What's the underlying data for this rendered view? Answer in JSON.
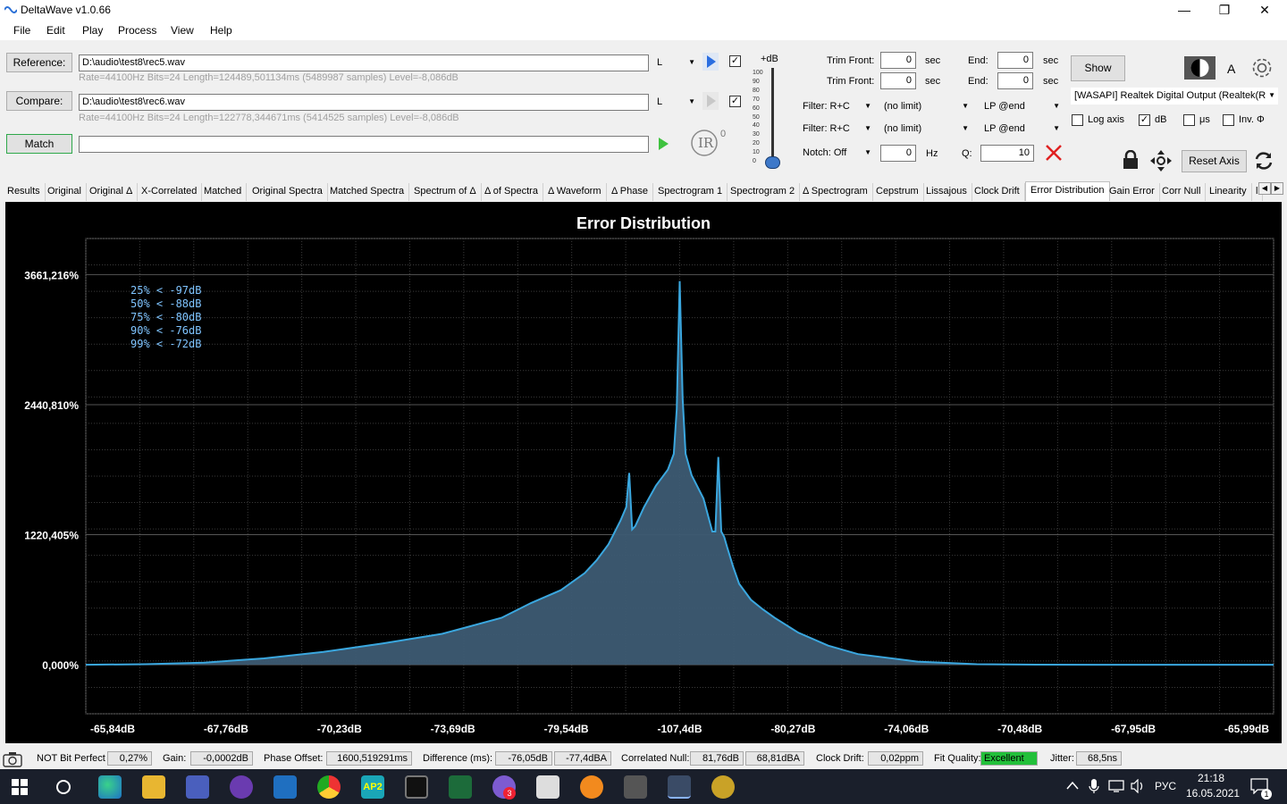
{
  "window": {
    "title": "DeltaWave v1.0.66",
    "minimize_glyph": "—",
    "maximize_glyph": "❐",
    "close_glyph": "✕"
  },
  "menu": [
    "File",
    "Edit",
    "Play",
    "Process",
    "View",
    "Help"
  ],
  "reference": {
    "button": "Reference:",
    "path": "D:\\audio\\test8\\rec5.wav",
    "channel": "L",
    "info": "Rate=44100Hz Bits=24 Length=124489,501134ms (5489987 samples) Level=-8,086dB"
  },
  "compare": {
    "button": "Compare:",
    "path": "D:\\audio\\test8\\rec6.wav",
    "channel": "L",
    "info": "Rate=44100Hz Bits=24 Length=122778,344671ms (5414525 samples) Level=-8,086dB"
  },
  "match": {
    "button": "Match",
    "field": ""
  },
  "ir": {
    "label": "IR",
    "sup": "0"
  },
  "level_slider": {
    "label": "+dB",
    "ticks": [
      "100",
      "90",
      "80",
      "70",
      "60",
      "50",
      "40",
      "30",
      "20",
      "10",
      "0"
    ],
    "value": 0
  },
  "trim": {
    "front_label": "Trim Front:",
    "end_label": "End:",
    "unit": "sec",
    "row1": {
      "front": "0",
      "end": "0"
    },
    "row2": {
      "front": "0",
      "end": "0"
    }
  },
  "filters": {
    "row1": {
      "filter": "Filter: R+C",
      "limit": "(no limit)",
      "lp": "LP @end"
    },
    "row2": {
      "filter": "Filter: R+C",
      "limit": "(no limit)",
      "lp": "LP @end"
    },
    "notch": "Notch: Off",
    "notch_value": "0",
    "notch_unit": "Hz",
    "q_label": "Q:",
    "q_value": "10"
  },
  "right_panel": {
    "show_button": "Show",
    "a_label": "A",
    "output_device": "[WASAPI] Realtek Digital Output (Realtek(R",
    "log_axis": "Log axis",
    "db": "dB",
    "us": "μs",
    "inv": "Inv. Φ",
    "checked_mark": "✓",
    "reset_axis": "Reset Axis"
  },
  "tabs": [
    "Results",
    "Original",
    "Original Δ",
    "X-Correlated",
    "Matched",
    "Original Spectra",
    "Matched Spectra",
    "Spectrum of Δ",
    "Δ of Spectra",
    "Δ Waveform",
    "Δ Phase",
    "Spectrogram 1",
    "Spectrogram 2",
    "Δ Spectrogram",
    "Cepstrum",
    "Lissajous",
    "Clock Drift",
    "Error Distribution",
    "Gain Error",
    "Corr Null",
    "Linearity",
    "l"
  ],
  "active_tab": "Error Distribution",
  "chart_data": {
    "type": "area",
    "title": "Error Distribution",
    "x_tick_labels": [
      "-65,84dB",
      "-67,76dB",
      "-70,23dB",
      "-73,69dB",
      "-79,54dB",
      "-107,4dB",
      "-80,27dB",
      "-74,06dB",
      "-70,48dB",
      "-67,95dB",
      "-65,99dB"
    ],
    "y_tick_labels": [
      "0,000%",
      "1220,405%",
      "2440,810%",
      "3661,216%"
    ],
    "ylim": [
      -460,
      4000
    ],
    "y_ticks": [
      0,
      1220.405,
      2440.81,
      3661.216
    ],
    "xlim": [
      -1,
      1
    ],
    "x": [
      -1,
      -0.9,
      -0.8,
      -0.7,
      -0.6,
      -0.5,
      -0.4,
      -0.3,
      -0.25,
      -0.2,
      -0.16,
      -0.14,
      -0.12,
      -0.1,
      -0.09,
      -0.085,
      -0.08,
      -0.075,
      -0.07,
      -0.06,
      -0.04,
      -0.02,
      -0.01,
      -0.005,
      0,
      0.005,
      0.01,
      0.02,
      0.04,
      0.055,
      0.06,
      0.065,
      0.07,
      0.075,
      0.08,
      0.09,
      0.1,
      0.12,
      0.14,
      0.16,
      0.2,
      0.25,
      0.3,
      0.4,
      0.5,
      0.6,
      0.7,
      0.8,
      0.9,
      1
    ],
    "y": [
      0,
      5,
      20,
      60,
      120,
      200,
      290,
      440,
      580,
      700,
      860,
      980,
      1130,
      1350,
      1480,
      1800,
      1270,
      1300,
      1360,
      1480,
      1680,
      1830,
      1980,
      2400,
      3600,
      2500,
      1980,
      1780,
      1560,
      1250,
      1250,
      1950,
      1250,
      1200,
      1100,
      920,
      760,
      610,
      520,
      440,
      300,
      180,
      100,
      30,
      5,
      1,
      0,
      0,
      0,
      0
    ],
    "percentiles": [
      "25% < -97dB",
      "50% < -88dB",
      "75% < -80dB",
      "90% < -76dB",
      "99% < -72dB"
    ],
    "grid": true,
    "colors": {
      "line": "#3aa7df",
      "fill": "#3d5b73",
      "grid": "#3a3a3a",
      "background": "#000000"
    }
  },
  "status": {
    "bit_perfect": "NOT Bit Perfect",
    "bit_perfect_value": "0,27%",
    "gain_label": "Gain:",
    "gain": "-0,0002dB",
    "phase_label": "Phase Offset:",
    "phase": "1600,519291ms",
    "diff_label": "Difference (ms):",
    "diff1": "-76,05dB",
    "diff2": "-77,4dBA",
    "null_label": "Correlated Null:",
    "null1": "81,76dB",
    "null2": "68,81dBA",
    "drift_label": "Clock Drift:",
    "drift": "0,02ppm",
    "fit_label": "Fit Quality:",
    "fit": "Excellent",
    "jitter_label": "Jitter:",
    "jitter": "68,5ns"
  },
  "taskbar": {
    "lang": "РУС",
    "time": "21:18",
    "date": "16.05.2021",
    "notif": "1",
    "viber_badge": "3",
    "ap2_label": "AP2"
  }
}
